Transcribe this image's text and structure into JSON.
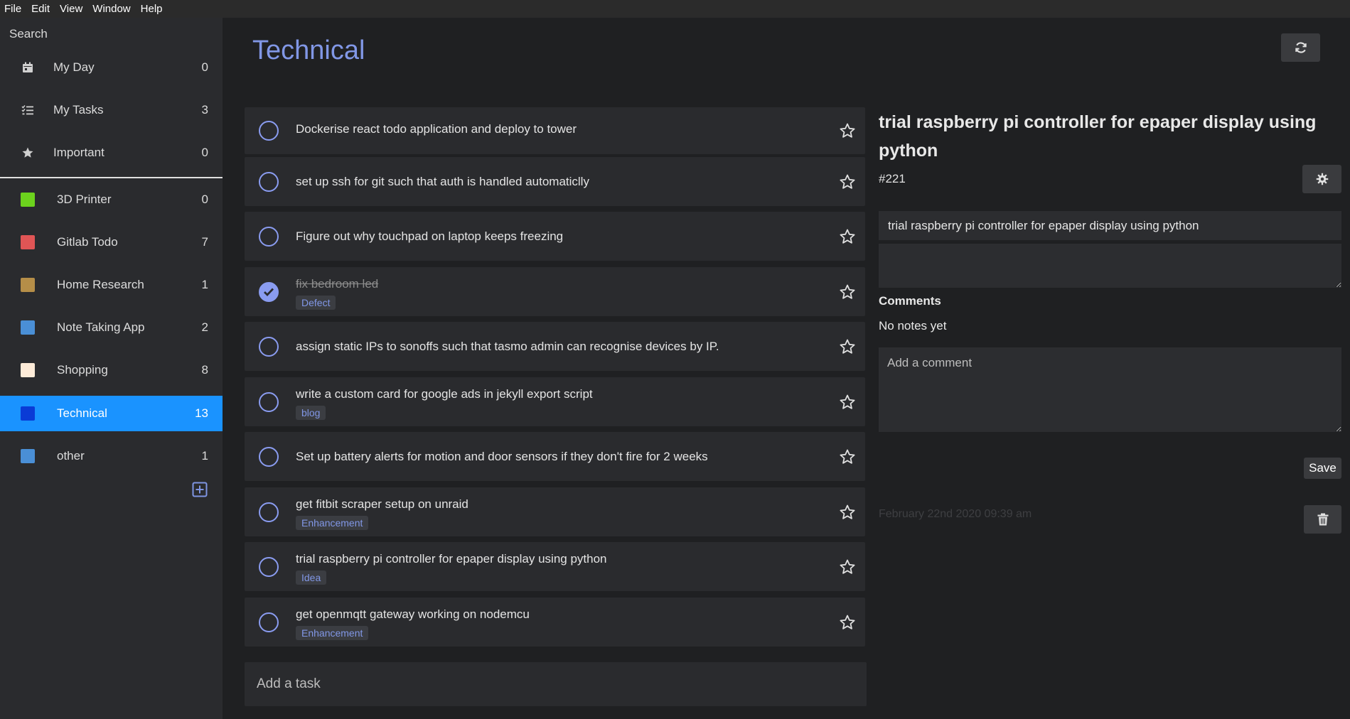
{
  "menu": [
    "File",
    "Edit",
    "View",
    "Window",
    "Help"
  ],
  "sidebar": {
    "search_placeholder": "Search",
    "smart_lists": [
      {
        "label": "My Day",
        "count": "0",
        "icon": "calendar-icon"
      },
      {
        "label": "My Tasks",
        "count": "3",
        "icon": "checklist-icon"
      },
      {
        "label": "Important",
        "count": "0",
        "icon": "star-icon"
      }
    ],
    "lists": [
      {
        "label": "3D Printer",
        "count": "0",
        "color": "#6cd21d"
      },
      {
        "label": "Gitlab Todo",
        "count": "7",
        "color": "#e05555"
      },
      {
        "label": "Home Research",
        "count": "1",
        "color": "#b58e48"
      },
      {
        "label": "Note Taking App",
        "count": "2",
        "color": "#4a8fd6"
      },
      {
        "label": "Shopping",
        "count": "8",
        "color": "#fdebd8"
      },
      {
        "label": "Technical",
        "count": "13",
        "color": "#0a3bd6",
        "active": true
      },
      {
        "label": "other",
        "count": "1",
        "color": "#4a8fd6"
      }
    ]
  },
  "main": {
    "title": "Technical",
    "add_task_placeholder": "Add a task",
    "tasks": [
      {
        "title": "Dockerise react todo application and deploy to tower",
        "tag": null,
        "done": false
      },
      {
        "title": "set up ssh for git such that auth is handled automaticlly",
        "tag": null,
        "done": false
      },
      {
        "title": "Figure out why touchpad on laptop keeps freezing",
        "tag": null,
        "done": false
      },
      {
        "title": "fix bedroom led",
        "tag": "Defect",
        "done": true
      },
      {
        "title": "assign static IPs to sonoffs such that tasmo admin can recognise devices by IP.",
        "tag": null,
        "done": false
      },
      {
        "title": "write a custom card for google ads in jekyll export script",
        "tag": "blog",
        "done": false
      },
      {
        "title": "Set up battery alerts for motion and door sensors if they don't fire for 2 weeks",
        "tag": null,
        "done": false
      },
      {
        "title": "get fitbit scraper setup on unraid",
        "tag": "Enhancement",
        "done": false
      },
      {
        "title": "trial raspberry pi controller for epaper display using python",
        "tag": "Idea",
        "done": false
      },
      {
        "title": "get openmqtt gateway working on nodemcu",
        "tag": "Enhancement",
        "done": false
      }
    ]
  },
  "detail": {
    "title": "trial raspberry pi controller for epaper display using python",
    "id": "#221",
    "name_value": "trial raspberry pi controller for epaper display using python",
    "comments_label": "Comments",
    "no_notes": "No notes yet",
    "comment_placeholder": "Add a comment",
    "save_label": "Save",
    "timestamp": "February 22nd 2020 09:39 am"
  },
  "colors": {
    "accent": "#8197e6",
    "active_bg": "#1a93ff",
    "check": "#8a9cf0"
  }
}
